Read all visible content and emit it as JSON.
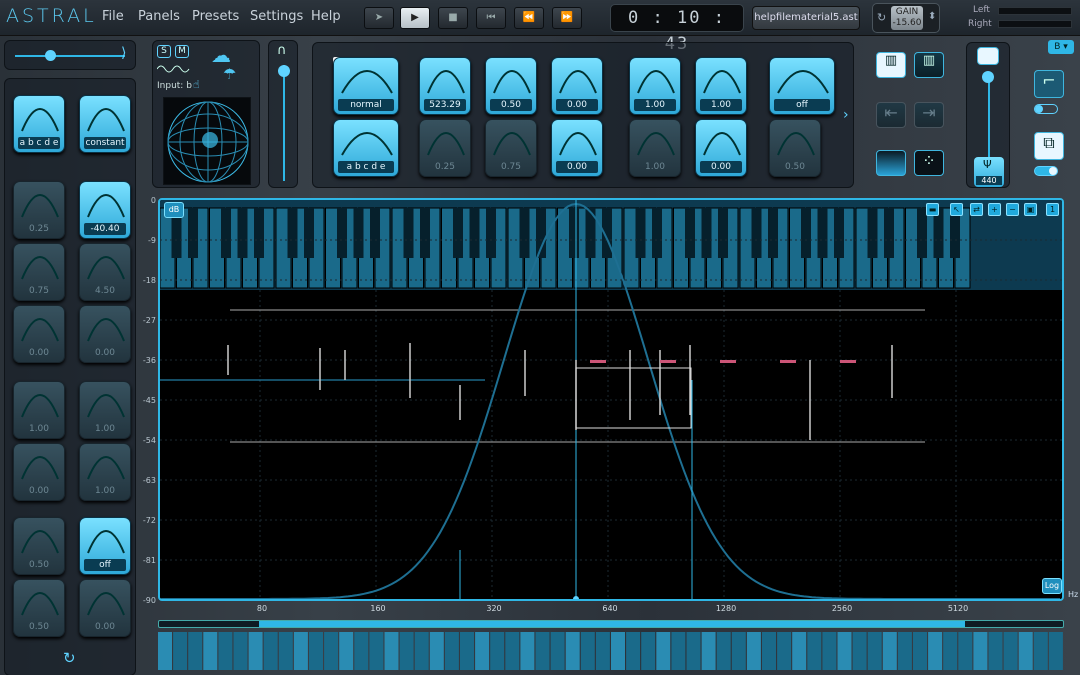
{
  "app": {
    "logo": "ASTRAL"
  },
  "menu": [
    "File",
    "Panels",
    "Presets",
    "Settings",
    "Help"
  ],
  "transport": {
    "time": "0 : 10 : 43",
    "file": "helpfilematerial5.ast",
    "gain_label": "GAIN",
    "gain_value": "-15.60",
    "meter_left": "Left",
    "meter_right": "Right"
  },
  "input": {
    "s_label": "S",
    "m_label": "M",
    "input_label": "Input: b"
  },
  "top_knobs": [
    {
      "val": "normal",
      "wide": true
    },
    {
      "val": "523.29"
    },
    {
      "val": "0.50"
    },
    {
      "val": "0.00"
    },
    {
      "val": "1.00"
    },
    {
      "val": "1.00"
    },
    {
      "val": "off",
      "wide": true
    }
  ],
  "top_knobs2": [
    {
      "val": "a b c d e",
      "wide": true
    },
    {
      "val": "0.25"
    },
    {
      "val": "0.75"
    },
    {
      "val": "0.00"
    },
    {
      "val": "1.00"
    },
    {
      "val": "0.00"
    },
    {
      "val": "0.50"
    }
  ],
  "left_knobs": [
    [
      "a b c d e",
      "constant"
    ],
    [
      "0.25",
      "-40.40"
    ],
    [
      "0.75",
      "4.50"
    ],
    [
      "0.00",
      "0.00"
    ],
    [
      "1.00",
      "1.00"
    ],
    [
      "0.00",
      "1.00"
    ],
    [
      "0.50",
      "off"
    ],
    [
      "0.50",
      "0.00"
    ]
  ],
  "right": {
    "tuning": "440",
    "channel": "B"
  },
  "graph": {
    "db_button": "dB",
    "log_button": "Log",
    "hz_label": "Hz",
    "y_ticks": [
      "0",
      "-9",
      "-18",
      "-27",
      "-36",
      "-45",
      "-54",
      "-63",
      "-72",
      "-81",
      "-90"
    ],
    "x_ticks": [
      "80",
      "160",
      "320",
      "640",
      "1280",
      "2560",
      "5120"
    ]
  }
}
